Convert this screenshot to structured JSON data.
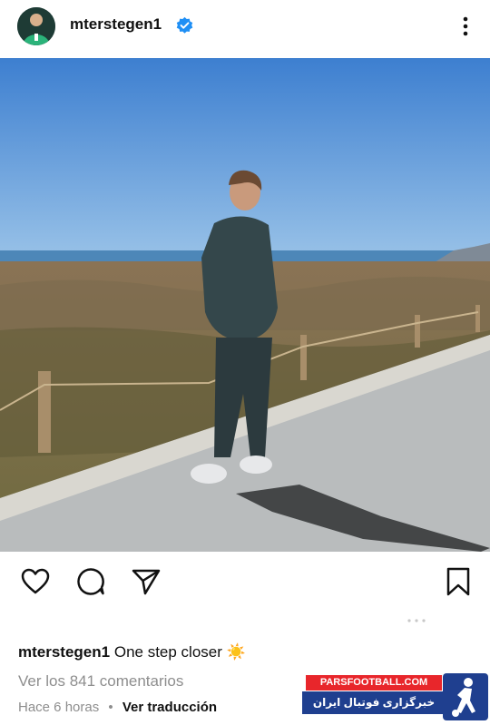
{
  "post": {
    "username": "mterstegen1",
    "caption_user": "mterstegen1",
    "caption_text": "One step closer",
    "caption_emoji": "☀️",
    "comments_link": "Ver los 841 comentarios",
    "time": "Hace 6 horas",
    "separator": "•",
    "translate": "Ver traducción"
  },
  "icons": {
    "avatar": "profile-avatar",
    "verified": "verified-badge-icon",
    "more": "more-options-icon",
    "like": "heart-icon",
    "comment": "comment-bubble-icon",
    "share": "paper-plane-icon",
    "save": "bookmark-icon"
  },
  "watermark": {
    "top": "PARSFOOTBALL.COM",
    "bottom": "خبرگزاری فوتبال ایران"
  },
  "colors": {
    "verified": "#1f8ff5",
    "watermark_red": "#e8262b",
    "watermark_blue": "#1f3f8f",
    "muted_text": "#8e8e8e"
  }
}
